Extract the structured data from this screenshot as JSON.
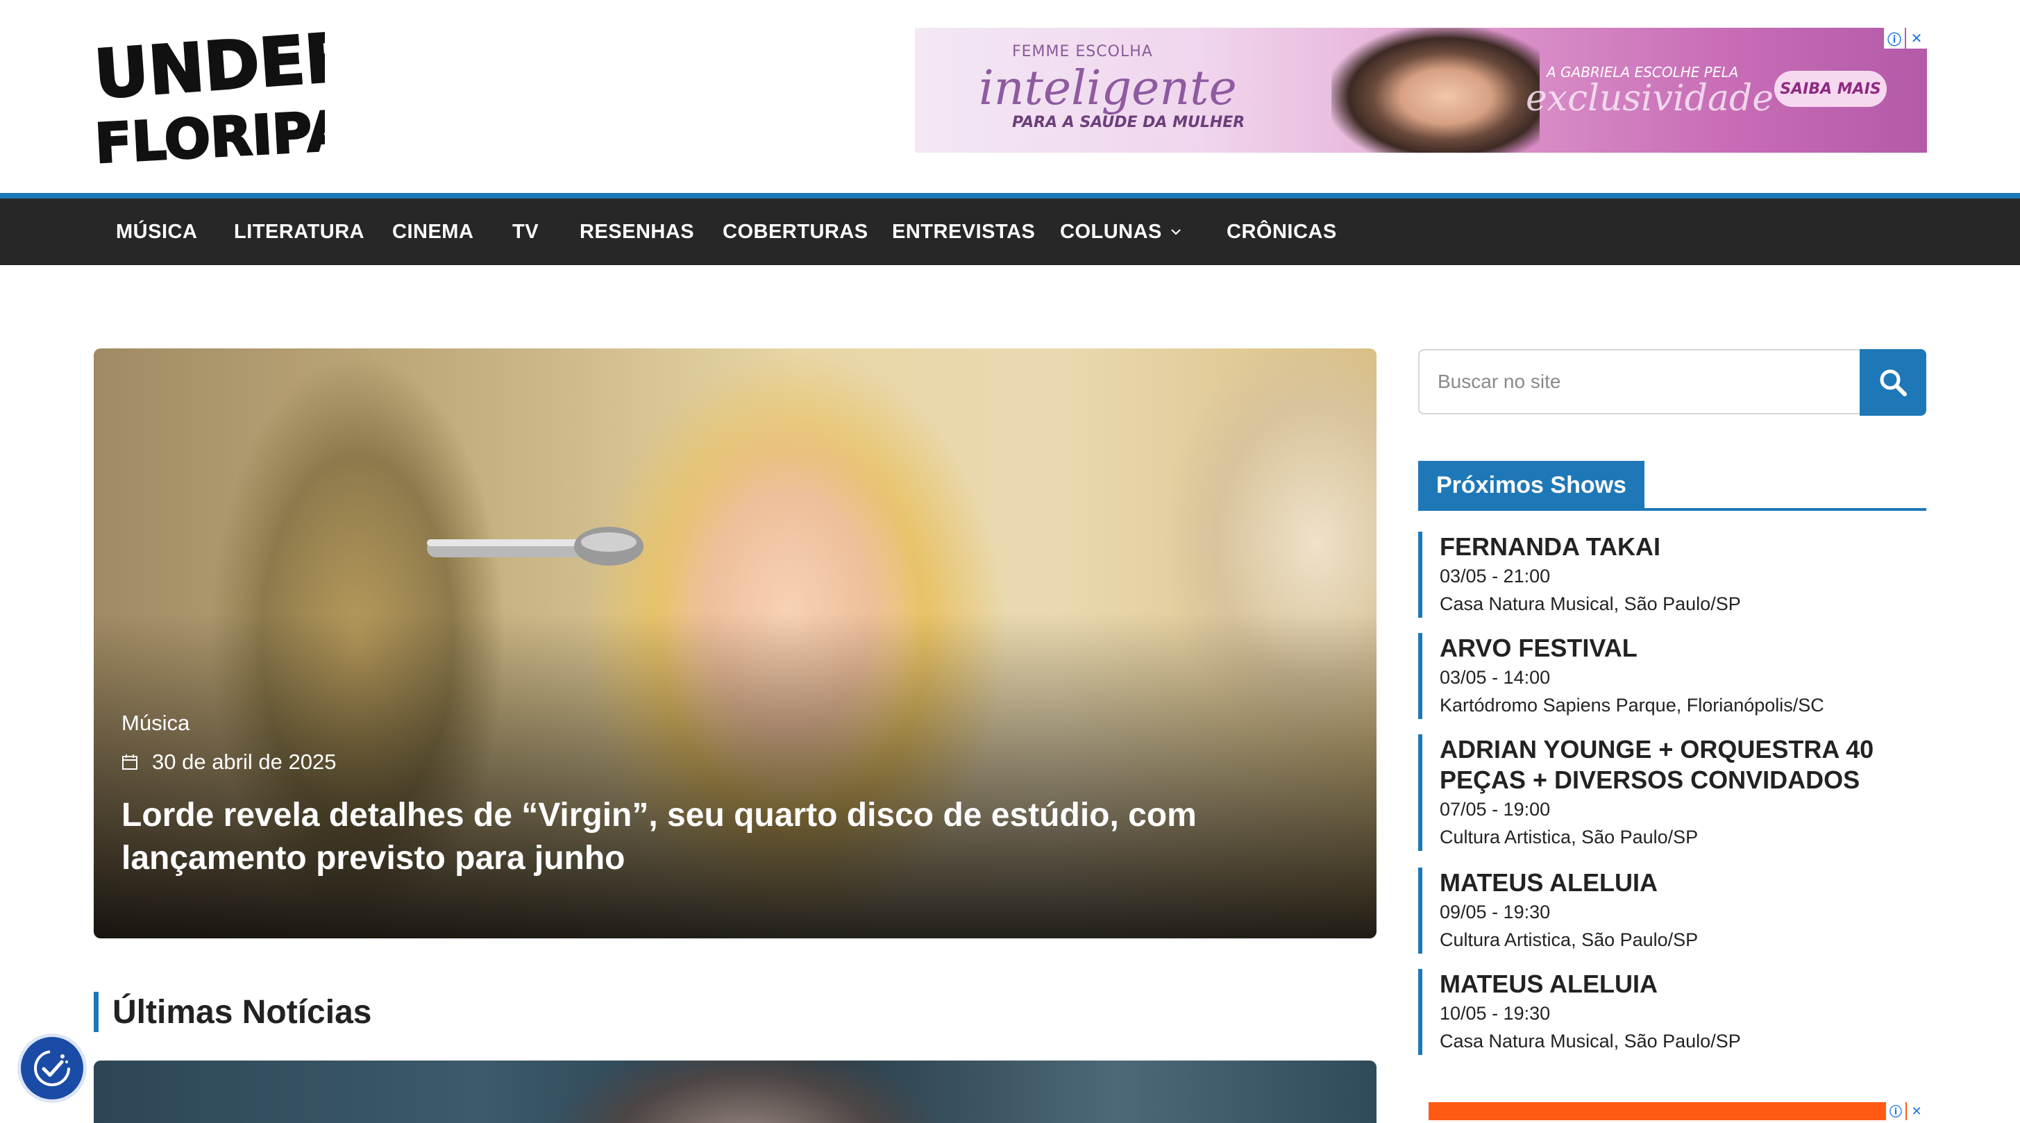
{
  "site": {
    "logo_text_line1": "UNDER",
    "logo_text_line2": "FLORIPA"
  },
  "top_ad": {
    "line1": "FEMME ESCOLHA",
    "headline": "inteligente",
    "line2": "PARA A SAÚDE DA MULHER",
    "line3": "A GABRIELA ESCOLHE PELA",
    "headline2": "exclusividade",
    "cta": "SAIBA MAIS",
    "info_icon": "ⓘ",
    "close_icon": "✕"
  },
  "nav": {
    "items": [
      {
        "label": "MÚSICA"
      },
      {
        "label": "LITERATURA"
      },
      {
        "label": "CINEMA"
      },
      {
        "label": "TV"
      },
      {
        "label": "RESENHAS"
      },
      {
        "label": "COBERTURAS"
      },
      {
        "label": "ENTREVISTAS"
      },
      {
        "label": "COLUNAS"
      },
      {
        "label": "CRÔNICAS"
      }
    ]
  },
  "hero": {
    "category": "Música",
    "date": "30 de abril de 2025",
    "title": "Lorde revela detalhes de “Virgin”, seu quarto disco de estúdio, com lançamento previsto para junho"
  },
  "latest": {
    "heading": "Últimas Notícias"
  },
  "sidebar": {
    "search_placeholder": "Buscar no site",
    "shows_heading": "Próximos Shows",
    "shows": [
      {
        "name": "FERNANDA TAKAI",
        "when": "03/05 - 21:00",
        "where": "Casa Natura Musical, São Paulo/SP"
      },
      {
        "name": "ARVO FESTIVAL",
        "when": "03/05 - 14:00",
        "where": "Kartódromo Sapiens Parque, Florianópolis/SC"
      },
      {
        "name": "ADRIAN YOUNGE + ORQUESTRA 40 PEÇAS + DIVERSOS CONVIDADOS",
        "when": "07/05 - 19:00",
        "where": "Cultura Artistica, São Paulo/SP"
      },
      {
        "name": "MATEUS ALELUIA",
        "when": "09/05 - 19:30",
        "where": "Cultura Artistica, São Paulo/SP"
      },
      {
        "name": "MATEUS ALELUIA",
        "when": "10/05 - 19:30",
        "where": "Casa Natura Musical, São Paulo/SP"
      }
    ]
  },
  "colors": {
    "accent": "#1e78b7",
    "nav_bg": "#272727",
    "a11y_bg": "#1a4ba6"
  },
  "icons": {
    "search": "search-icon",
    "calendar": "calendar-icon",
    "chevron": "chevron-down-icon",
    "accessibility": "accessibility-icon"
  }
}
